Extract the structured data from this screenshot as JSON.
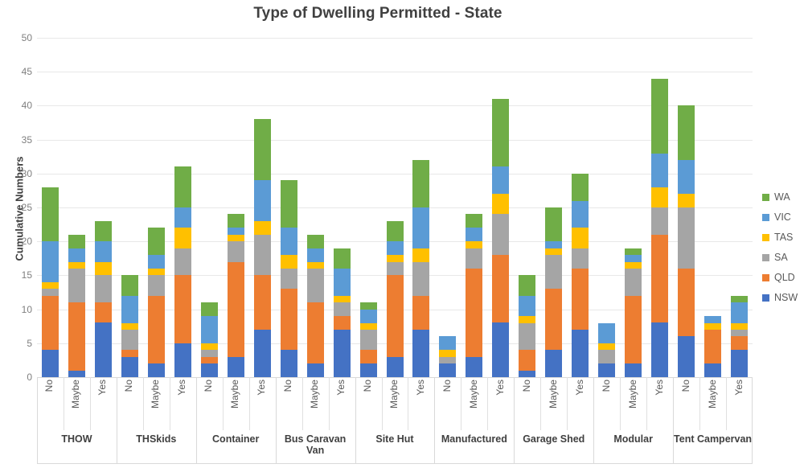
{
  "chart_data": {
    "type": "bar",
    "subtype": "stacked-bar-grouped",
    "title": "Type of Dwelling Permitted - State",
    "xlabel": "",
    "ylabel": "Cumulative Numbers",
    "ylim": [
      0,
      50
    ],
    "ytick_step": 5,
    "yticks": [
      0,
      5,
      10,
      15,
      20,
      25,
      30,
      35,
      40,
      45,
      50
    ],
    "grid": true,
    "legend_position": "right",
    "groups": [
      "THOW",
      "THSkids",
      "Container",
      "Bus Caravan Van",
      "Site Hut",
      "Manufactured",
      "Garage Shed",
      "Modular",
      "Tent Campervan"
    ],
    "subcategories": [
      "No",
      "Maybe",
      "Yes"
    ],
    "series": [
      {
        "name": "NSW",
        "color": "#4472c4",
        "values": [
          4,
          1,
          8,
          3,
          2,
          5,
          2,
          3,
          7,
          4,
          2,
          7,
          2,
          3,
          7,
          2,
          3,
          8,
          1,
          4,
          7,
          2,
          2,
          8,
          6,
          2,
          4
        ]
      },
      {
        "name": "QLD",
        "color": "#ed7d31",
        "values": [
          8,
          10,
          3,
          1,
          10,
          10,
          1,
          14,
          8,
          9,
          9,
          2,
          2,
          12,
          5,
          0,
          13,
          10,
          3,
          9,
          9,
          0,
          10,
          13,
          10,
          5,
          2
        ]
      },
      {
        "name": "SA",
        "color": "#a5a5a5",
        "values": [
          1,
          5,
          4,
          3,
          3,
          4,
          1,
          3,
          6,
          3,
          5,
          2,
          3,
          2,
          5,
          1,
          3,
          6,
          4,
          5,
          3,
          2,
          4,
          4,
          9,
          0,
          1
        ]
      },
      {
        "name": "TAS",
        "color": "#ffc000",
        "values": [
          1,
          1,
          2,
          1,
          1,
          3,
          1,
          1,
          2,
          2,
          1,
          1,
          1,
          1,
          2,
          1,
          1,
          3,
          1,
          1,
          3,
          1,
          1,
          3,
          2,
          1,
          1
        ]
      },
      {
        "name": "VIC",
        "color": "#5b9bd5",
        "values": [
          6,
          2,
          3,
          4,
          2,
          3,
          4,
          1,
          6,
          4,
          2,
          4,
          2,
          2,
          6,
          2,
          2,
          4,
          3,
          1,
          4,
          3,
          1,
          5,
          5,
          1,
          3
        ]
      },
      {
        "name": "WA",
        "color": "#70ad47",
        "values": [
          8,
          2,
          3,
          3,
          4,
          6,
          2,
          2,
          9,
          7,
          2,
          3,
          1,
          3,
          7,
          0,
          2,
          10,
          3,
          5,
          4,
          0,
          1,
          11,
          8,
          0,
          1
        ]
      }
    ],
    "bar_totals": [
      28,
      21,
      23,
      15,
      22,
      31,
      11,
      24,
      38,
      29,
      21,
      19,
      11,
      23,
      32,
      6,
      24,
      41,
      15,
      25,
      30,
      8,
      19,
      44,
      40,
      9,
      12
    ],
    "legend": [
      {
        "label": "WA",
        "color": "#70ad47"
      },
      {
        "label": "VIC",
        "color": "#5b9bd5"
      },
      {
        "label": "TAS",
        "color": "#ffc000"
      },
      {
        "label": "SA",
        "color": "#a5a5a5"
      },
      {
        "label": "QLD",
        "color": "#ed7d31"
      },
      {
        "label": "NSW",
        "color": "#4472c4"
      }
    ]
  }
}
